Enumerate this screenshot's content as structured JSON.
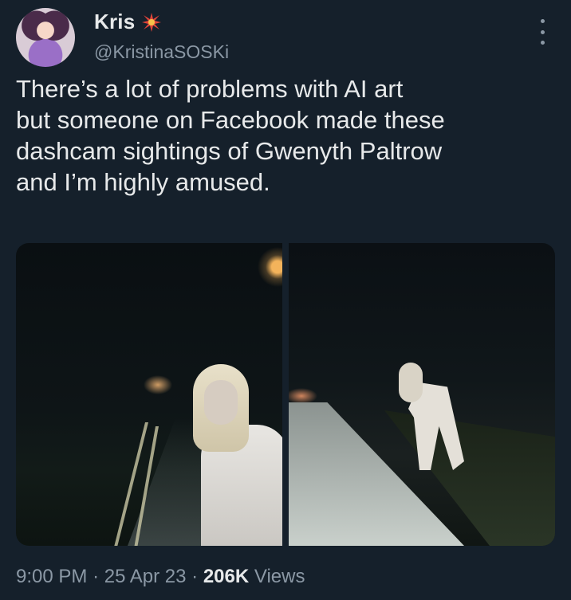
{
  "author": {
    "display_name": "Kris",
    "badge_icon": "sparkle-burst-icon",
    "handle": "@KristinaSOSKi"
  },
  "tweet": {
    "lines": [
      "There’s a lot of problems with AI art",
      "but someone on Facebook made these",
      "dashcam sightings of Gwenyth Paltrow",
      "and I’m highly amused."
    ]
  },
  "media": {
    "images": [
      {
        "subject": "left-photo"
      },
      {
        "subject": "right-photo"
      }
    ]
  },
  "meta": {
    "time": "9:00 PM",
    "separator": "·",
    "date": "25 Apr 23",
    "views_count": "206K",
    "views_label": "Views"
  },
  "colors": {
    "background": "#15202b",
    "primary_text": "#e7e9ea",
    "secondary_text": "#8b98a5",
    "badge": "#e0443a"
  }
}
